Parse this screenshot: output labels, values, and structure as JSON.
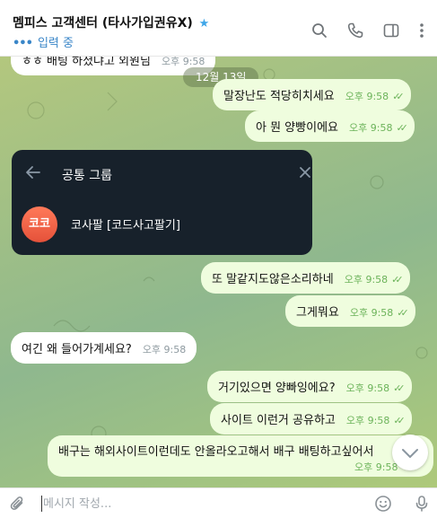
{
  "header": {
    "title": "멤피스 고객센터 (타사가입권유X)",
    "star": "★",
    "typing_dots": "•••",
    "status": "입력 중"
  },
  "chat": {
    "date_pill": "12월 13일",
    "messages": [
      {
        "text": "ㅎㅎ 배팅 하셨냐고 외원님",
        "time": "오후 9:58"
      },
      {
        "text": "말장난도 적당히치세요",
        "time": "오후 9:58",
        "ticks": "✓✓"
      },
      {
        "text": "아 뭔 양빵이에요",
        "time": "오후 9:58",
        "ticks": "✓✓"
      },
      {
        "text": "또 말같지도않은소리하네",
        "time": "오후 9:58",
        "ticks": "✓✓"
      },
      {
        "text": "그게뭐요",
        "time": "오후 9:58",
        "ticks": "✓✓"
      },
      {
        "text": "여긴 왜 들어가계세요?",
        "time": "오후 9:58"
      },
      {
        "text": "거기있으면 양빠잉에요?",
        "time": "오후 9:58",
        "ticks": "✓✓"
      },
      {
        "text": "사이트 이런거 공유하고",
        "time": "오후 9:58",
        "ticks": "✓✓"
      },
      {
        "text": "배구는 해외사이트이런데도 안올라오고해서 배구 배팅하고싶어서",
        "time": "오후 9:58"
      }
    ]
  },
  "popup": {
    "title": "공통 그룹",
    "avatar_text": "코코",
    "group_name": "코사팔 [코드사고팔기]"
  },
  "composer": {
    "placeholder": "메시지 작성..."
  },
  "colors": {
    "accent": "#3fa6e8",
    "outgoing_bubble": "#effdde",
    "popup_bg": "#17212b",
    "check_green": "#6cb35a"
  },
  "icons": [
    "search-icon",
    "phone-icon",
    "sidebar-icon",
    "more-icon",
    "back-arrow-icon",
    "close-icon",
    "chevron-down-icon",
    "attach-icon",
    "emoji-icon",
    "mic-icon"
  ]
}
